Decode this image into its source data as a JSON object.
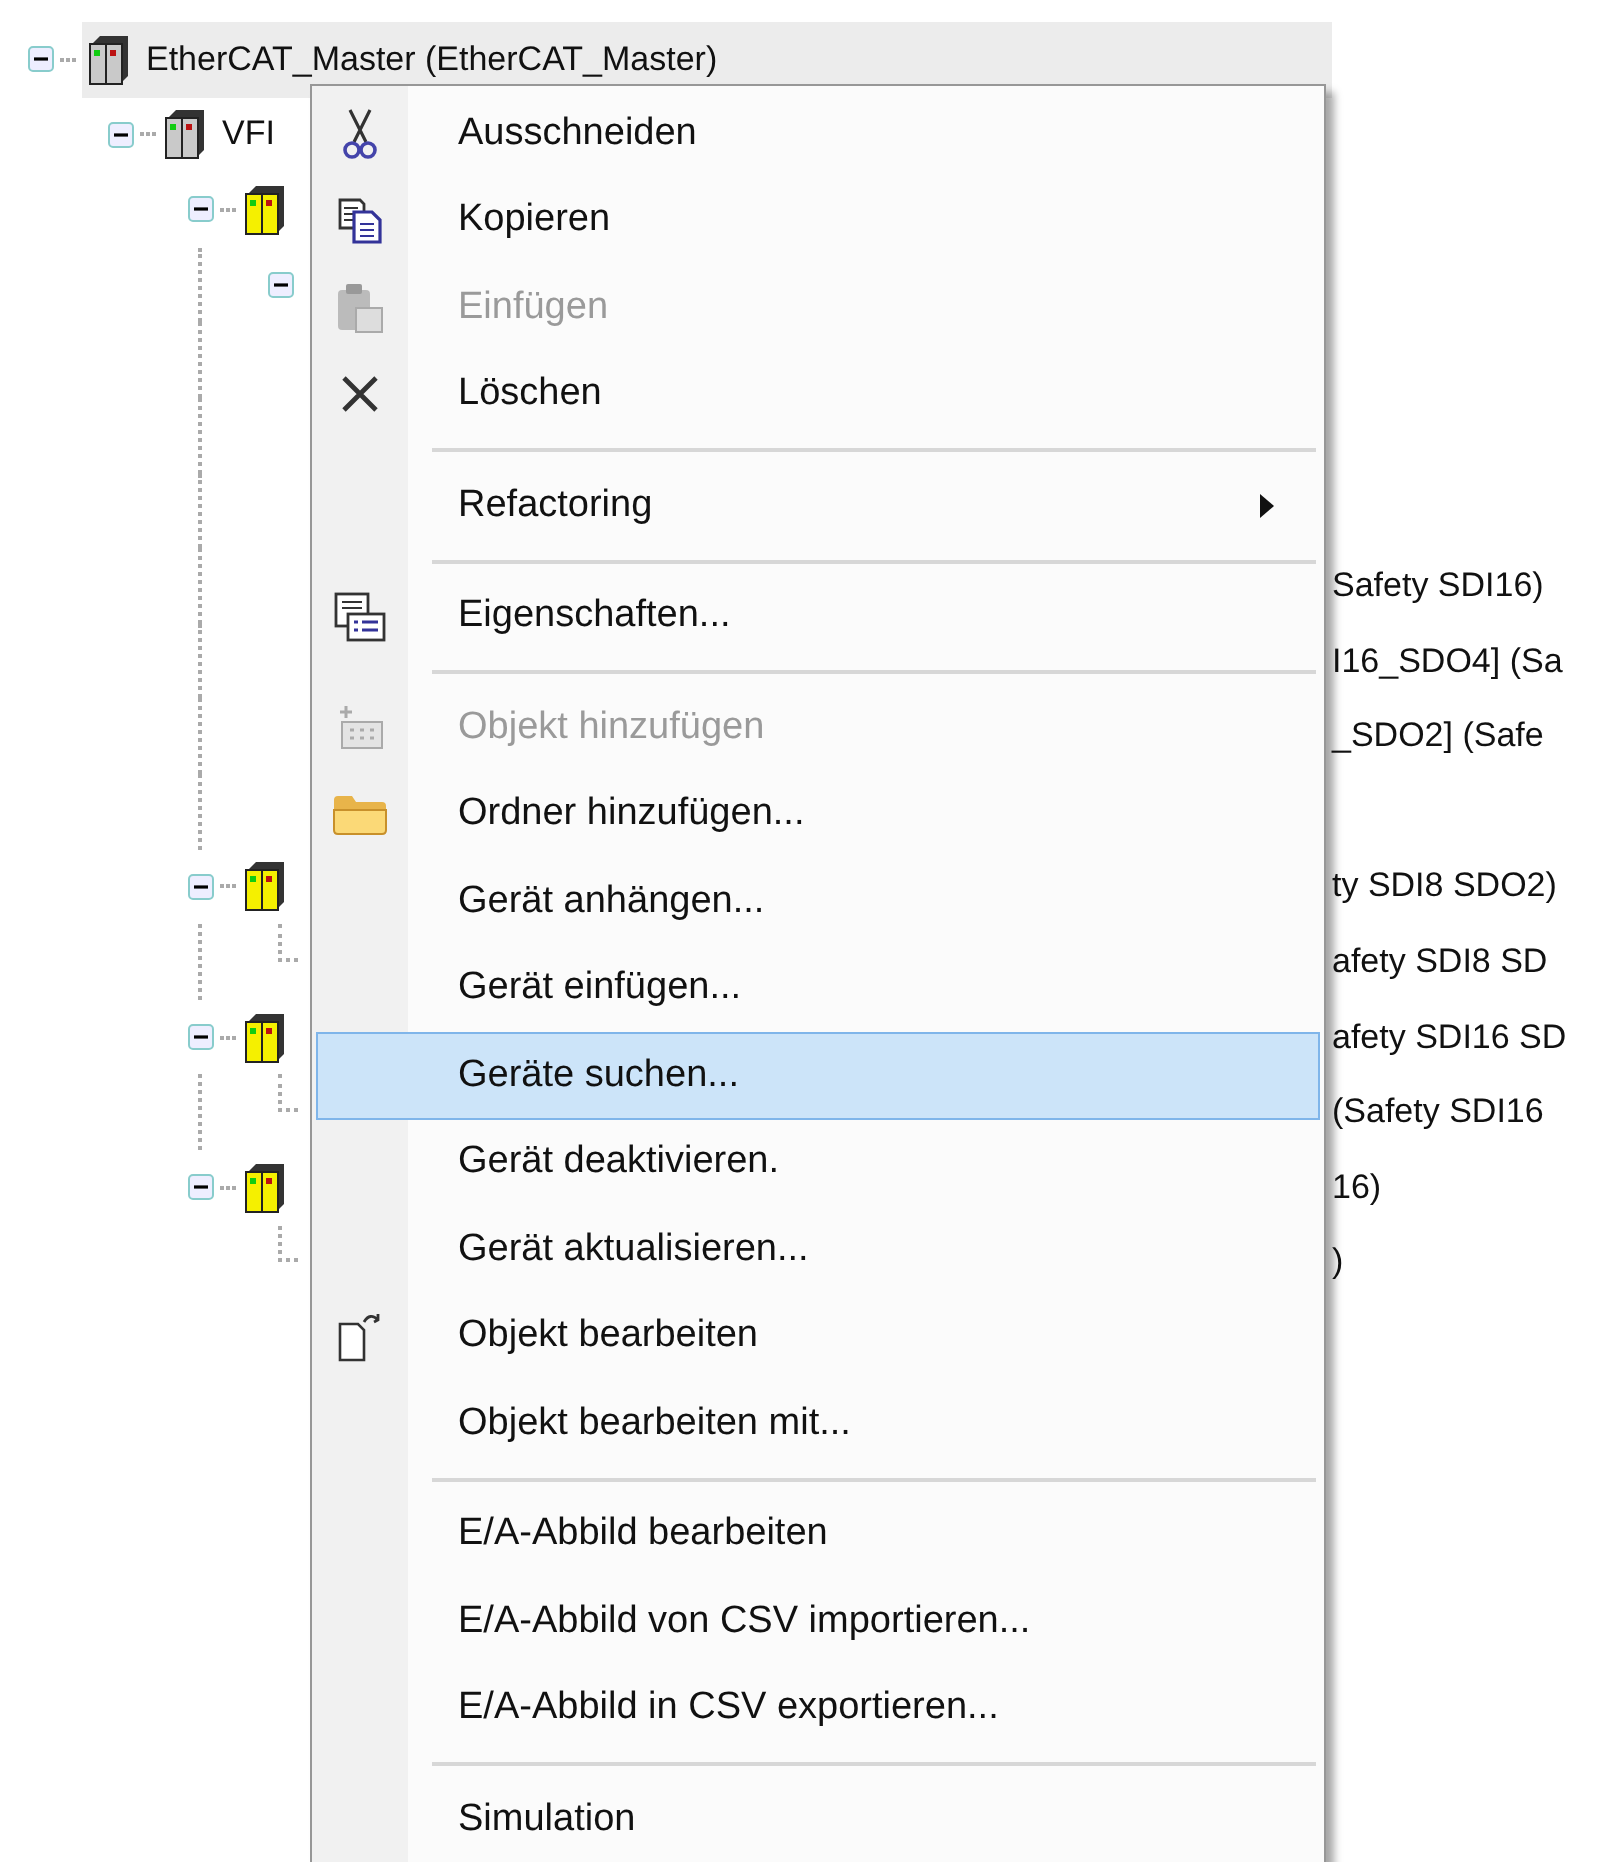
{
  "tree": [
    {
      "label": "EtherCAT_Master (EtherCAT_Master)",
      "color": "#c9c9c9",
      "expanded": true,
      "selected": true,
      "children": [
        {
          "label": "VFI",
          "color": "#c9c9c9",
          "expanded": true,
          "selected": false,
          "children": [
            {
              "color": "#f5f000",
              "expanded": true,
              "selected": false,
              "children": [
                {
                  "expanded": true,
                  "children": [
                    {
                      "tail": "Safety SDI16)"
                    },
                    {
                      "tail": "I16_SDO4]  (Sa"
                    },
                    {
                      "tail": "_SDO2]  (Safe"
                    }
                  ]
                }
              ]
            },
            {
              "color": "#f5f000",
              "expanded": true,
              "selected": false,
              "tail": "ty SDI8 SDO2)",
              "children": [
                {
                  "tail": "afety SDI8 SD"
                }
              ]
            },
            {
              "color": "#f5f000",
              "expanded": true,
              "selected": false,
              "tail": "afety SDI16 SD",
              "children": [
                {
                  "tail": "(Safety SDI16"
                }
              ]
            },
            {
              "color": "#f5f000",
              "expanded": true,
              "selected": false,
              "tail": "16)",
              "children": [
                {
                  "tail": ")"
                }
              ]
            }
          ]
        }
      ]
    }
  ],
  "context_menu": {
    "items": [
      {
        "kind": "cut",
        "label": "Ausschneiden",
        "disabled": false,
        "selected": false,
        "submenu": false
      },
      {
        "kind": "copy",
        "label": "Kopieren",
        "disabled": false,
        "selected": false,
        "submenu": false
      },
      {
        "kind": "paste",
        "label": "Einfügen",
        "disabled": true,
        "selected": false,
        "submenu": false
      },
      {
        "kind": "delete",
        "label": "Löschen",
        "disabled": false,
        "selected": false,
        "submenu": false
      },
      {
        "kind": "separator"
      },
      {
        "kind": "item",
        "label": "Refactoring",
        "disabled": false,
        "selected": false,
        "submenu": true
      },
      {
        "kind": "separator"
      },
      {
        "kind": "properties",
        "label": "Eigenschaften...",
        "disabled": false,
        "selected": false,
        "submenu": false
      },
      {
        "kind": "separator"
      },
      {
        "kind": "add",
        "label": "Objekt hinzufügen",
        "disabled": true,
        "selected": false,
        "submenu": false
      },
      {
        "kind": "folder",
        "label": "Ordner hinzufügen...",
        "disabled": false,
        "selected": false,
        "submenu": false
      },
      {
        "kind": "item",
        "label": "Gerät anhängen...",
        "disabled": false,
        "selected": false,
        "submenu": false
      },
      {
        "kind": "item",
        "label": "Gerät einfügen...",
        "disabled": false,
        "selected": false,
        "submenu": false
      },
      {
        "kind": "item",
        "label": "Geräte suchen...",
        "disabled": false,
        "selected": true,
        "submenu": false
      },
      {
        "kind": "item",
        "label": "Gerät deaktivieren.",
        "disabled": false,
        "selected": false,
        "submenu": false
      },
      {
        "kind": "item",
        "label": "Gerät aktualisieren...",
        "disabled": false,
        "selected": false,
        "submenu": false
      },
      {
        "kind": "edit",
        "label": "Objekt bearbeiten",
        "disabled": false,
        "selected": false,
        "submenu": false
      },
      {
        "kind": "item",
        "label": "Objekt bearbeiten mit...",
        "disabled": false,
        "selected": false,
        "submenu": false
      },
      {
        "kind": "separator"
      },
      {
        "kind": "item",
        "label": "E/A-Abbild bearbeiten",
        "disabled": false,
        "selected": false,
        "submenu": false
      },
      {
        "kind": "item",
        "label": "E/A-Abbild von CSV importieren...",
        "disabled": false,
        "selected": false,
        "submenu": false
      },
      {
        "kind": "item",
        "label": "E/A-Abbild in CSV exportieren...",
        "disabled": false,
        "selected": false,
        "submenu": false
      },
      {
        "kind": "separator"
      },
      {
        "kind": "item",
        "label": "Simulation",
        "disabled": false,
        "selected": false,
        "submenu": false
      }
    ]
  }
}
